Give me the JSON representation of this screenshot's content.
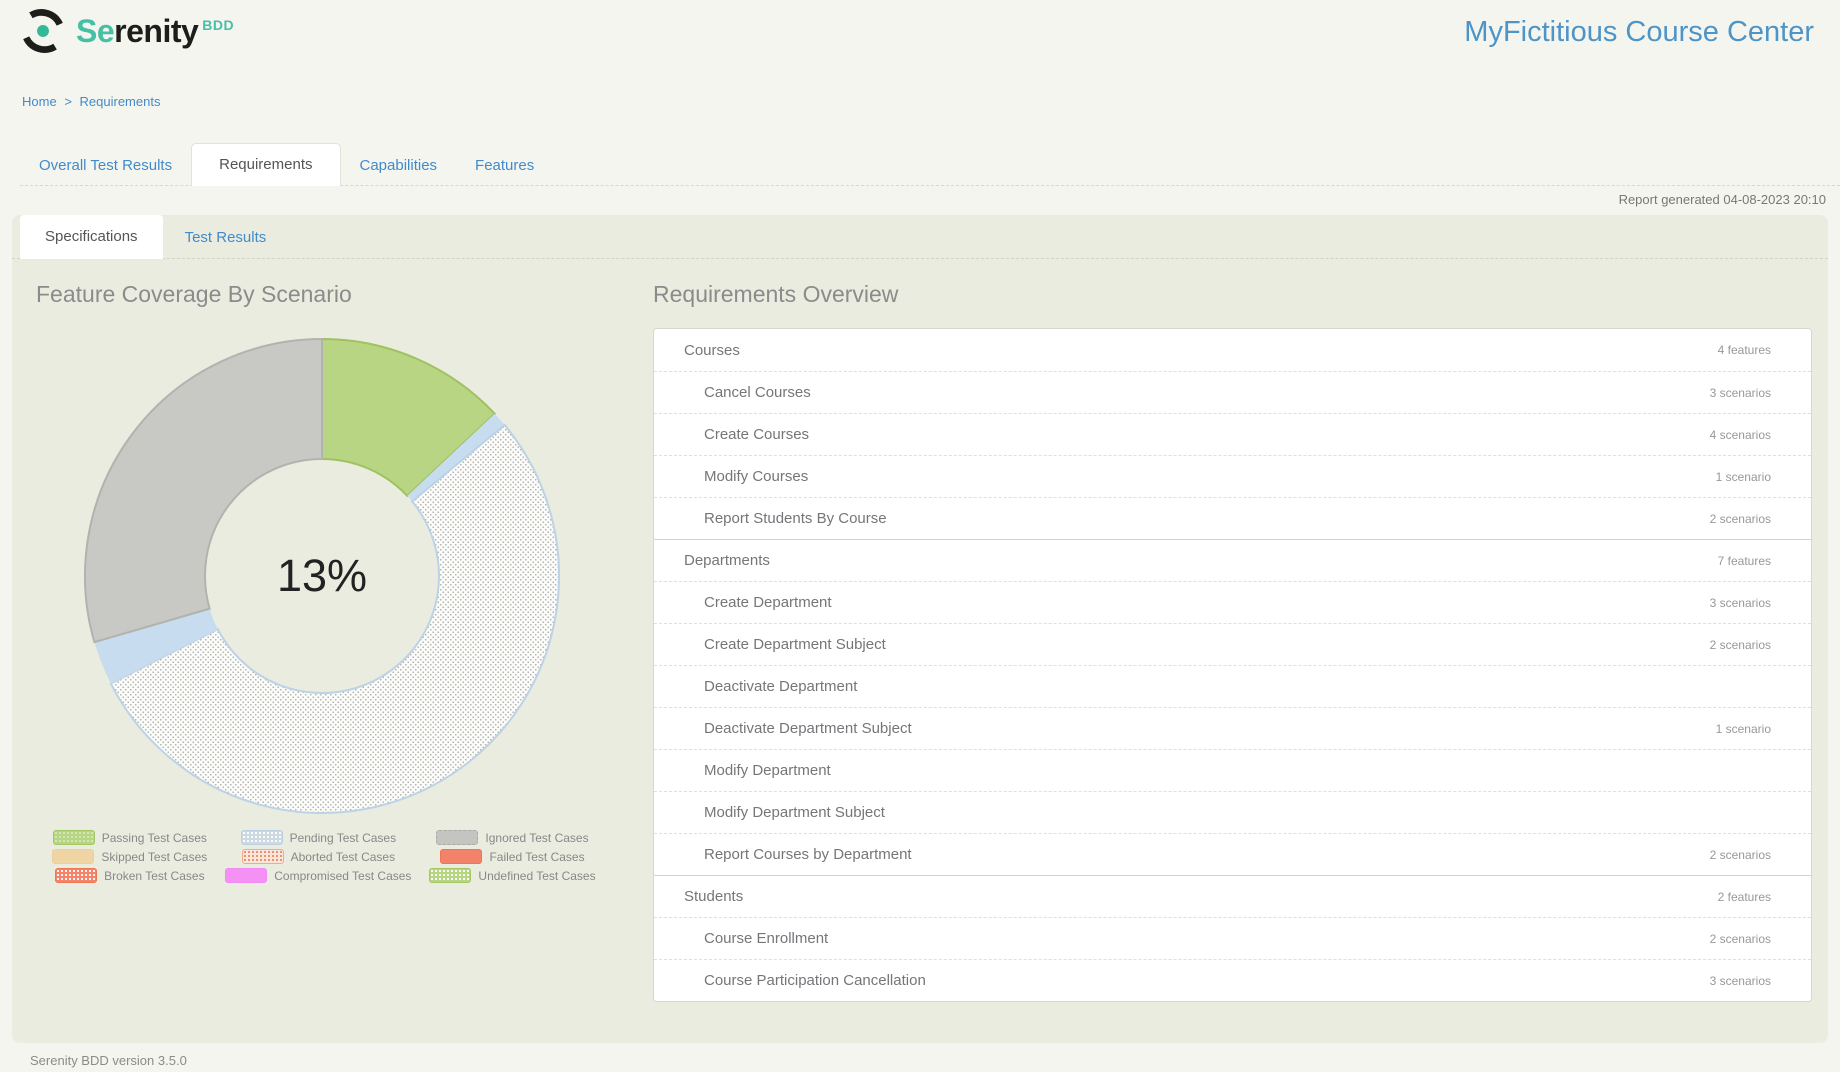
{
  "header": {
    "brand_se": "Se",
    "brand_rest": "renity",
    "brand_sub": "BDD",
    "project_title": "MyFictitious Course Center"
  },
  "breadcrumb": {
    "items": [
      {
        "label": "Home"
      },
      {
        "label": "Requirements"
      }
    ],
    "separator": ">"
  },
  "main_tabs": [
    {
      "label": "Overall Test Results",
      "active": false
    },
    {
      "label": "Requirements",
      "active": true
    },
    {
      "label": "Capabilities",
      "active": false
    },
    {
      "label": "Features",
      "active": false
    }
  ],
  "report_generated": "Report generated 04-08-2023 20:10",
  "sub_tabs": [
    {
      "label": "Specifications",
      "active": true
    },
    {
      "label": "Test Results",
      "active": false
    }
  ],
  "chart_data": {
    "type": "donut",
    "title": "Feature Coverage By Scenario",
    "center_label": "13%",
    "legend_position": "bottom",
    "segments": [
      {
        "name": "passing",
        "percent": 13,
        "fill": "#b8d584",
        "stroke": "#9fc25f"
      },
      {
        "name": "pending-edge",
        "percent": 1,
        "fill": "#c7dcef",
        "stroke": "none"
      },
      {
        "name": "pending",
        "percent": 53.5,
        "fill": "dots",
        "stroke": "#bcd2e6"
      },
      {
        "name": "pending-edge-2",
        "percent": 3,
        "fill": "#c7dcef",
        "stroke": "none"
      },
      {
        "name": "ignored",
        "percent": 29.5,
        "fill": "#c8c8c5",
        "stroke": "#b2b2af"
      }
    ],
    "legend": [
      {
        "label": "Passing Test Cases",
        "bg": "#b8d584",
        "border": "#a4c765",
        "dots": "rgba(255,255,255,0.45)"
      },
      {
        "label": "Pending Test Cases",
        "bg": "#cdd9e1",
        "border": "#bad0e2",
        "dots": "#ffffff"
      },
      {
        "label": "Ignored Test Cases",
        "bg": "#c4c4c1",
        "border": "#a9a9a5",
        "dashed": true
      },
      {
        "label": "Skipped Test Cases",
        "bg": "#f0d5a4",
        "border": "#ecd09c"
      },
      {
        "label": "Aborted Test Cases",
        "bg": "#fbe7da",
        "border": "#f5a88e",
        "dots": "#e88a68"
      },
      {
        "label": "Failed Test Cases",
        "bg": "#f3826a",
        "border": "#ef764f"
      },
      {
        "label": "Broken Test Cases",
        "bg": "#f3836b",
        "border": "#ef764f",
        "dots": "#ffffff"
      },
      {
        "label": "Compromised Test Cases",
        "bg": "#f590f5",
        "border": "#f18af1"
      },
      {
        "label": "Undefined Test Cases",
        "bg": "#b8d584",
        "border": "#a4c765",
        "dots": "#ffffff"
      }
    ]
  },
  "overview": {
    "title": "Requirements Overview",
    "rows": [
      {
        "label": "Courses",
        "level": 0,
        "count": "4 features"
      },
      {
        "label": "Cancel Courses",
        "level": 1,
        "count": "3 scenarios"
      },
      {
        "label": "Create Courses",
        "level": 1,
        "count": "4 scenarios"
      },
      {
        "label": "Modify Courses",
        "level": 1,
        "count": "1 scenario"
      },
      {
        "label": "Report Students By Course",
        "level": 1,
        "count": "2 scenarios"
      },
      {
        "label": "Departments",
        "level": 0,
        "count": "7 features"
      },
      {
        "label": "Create Department",
        "level": 1,
        "count": "3 scenarios"
      },
      {
        "label": "Create Department Subject",
        "level": 1,
        "count": "2 scenarios"
      },
      {
        "label": "Deactivate Department",
        "level": 1,
        "count": ""
      },
      {
        "label": "Deactivate Department Subject",
        "level": 1,
        "count": "1 scenario"
      },
      {
        "label": "Modify Department",
        "level": 1,
        "count": ""
      },
      {
        "label": "Modify Department Subject",
        "level": 1,
        "count": ""
      },
      {
        "label": "Report Courses by Department",
        "level": 1,
        "count": "2 scenarios"
      },
      {
        "label": "Students",
        "level": 0,
        "count": "2 features"
      },
      {
        "label": "Course Enrollment",
        "level": 1,
        "count": "2 scenarios"
      },
      {
        "label": "Course Participation Cancellation",
        "level": 1,
        "count": "3 scenarios"
      }
    ]
  },
  "footer": {
    "version": "Serenity BDD version 3.5.0"
  },
  "colors": {
    "brand_teal": "#45c0a5",
    "link_blue": "#428bca",
    "title_blue": "#4d94c7",
    "panel_bg": "#ebece0",
    "page_bg": "#f5f5ef"
  }
}
